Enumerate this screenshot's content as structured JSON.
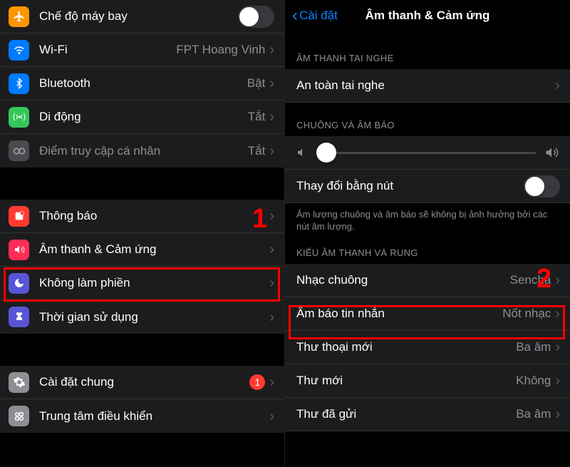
{
  "left": {
    "items": {
      "airplane": "Chế độ máy bay",
      "wifi_label": "Wi-Fi",
      "wifi_value": "FPT Hoang Vinh",
      "bluetooth_label": "Bluetooth",
      "bluetooth_value": "Bật",
      "cellular_label": "Di động",
      "cellular_value": "Tắt",
      "hotspot_label": "Điểm truy cập cá nhân",
      "hotspot_value": "Tắt",
      "notifications": "Thông báo",
      "sounds": "Âm thanh & Cảm ứng",
      "dnd": "Không làm phiền",
      "screentime": "Thời gian sử dụng",
      "general": "Cài đặt chung",
      "general_badge": "1",
      "control_center": "Trung tâm điều khiển"
    },
    "step": "1"
  },
  "right": {
    "back": "Cài đặt",
    "title": "Âm thanh & Cảm ứng",
    "group_headphone": "ÂM THANH TAI NGHE",
    "headphone_safety": "An toàn tai nghe",
    "group_ringer": "CHUÔNG VÀ ÂM BÁO",
    "change_with_buttons": "Thay đổi bằng nút",
    "footer": "Âm lượng chuông và âm báo sẽ không bị ảnh hưởng bởi các nút âm lượng.",
    "group_sounds": "KIỂU ÂM THANH VÀ RUNG",
    "ringtone_label": "Nhạc chuông",
    "ringtone_value": "Sencha",
    "texttone_label": "Âm báo tin nhắn",
    "texttone_value": "Nốt nhạc",
    "voicemail_label": "Thư thoại mới",
    "voicemail_value": "Ba âm",
    "newmail_label": "Thư mới",
    "newmail_value": "Không",
    "sentmail_label": "Thư đã gửi",
    "sentmail_value": "Ba âm",
    "step": "2"
  }
}
